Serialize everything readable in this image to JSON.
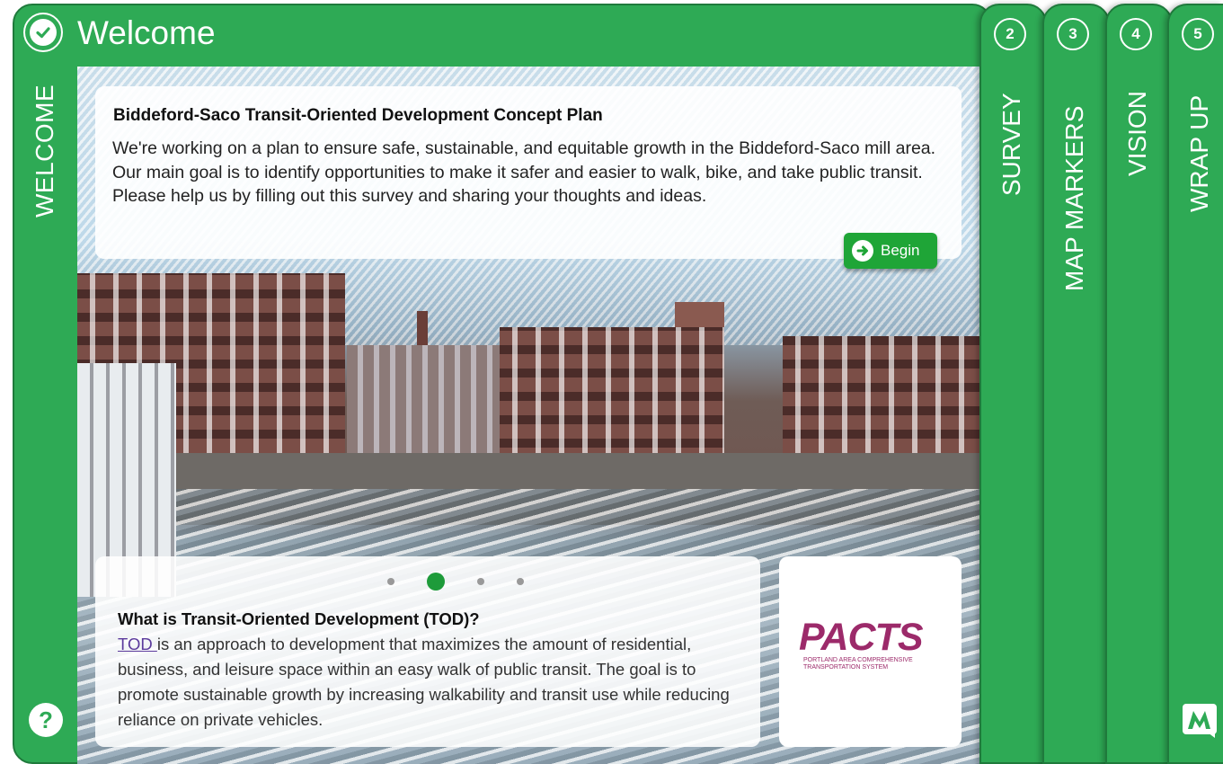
{
  "header": {
    "title": "Welcome"
  },
  "side": {
    "welcome_label": "WELCOME",
    "help_glyph": "?"
  },
  "intro": {
    "title": "Biddeford-Saco Transit-Oriented Development Concept Plan",
    "body": "We're working on a plan to ensure safe, sustainable, and equitable growth in the Biddeford-Saco mill area. Our main goal is to identify opportunities to make it safer and easier to walk, bike, and take public transit. Please help us by filling out this survey and sharing your thoughts and ideas.",
    "begin_label": "Begin"
  },
  "tod": {
    "title": "What is Transit-Oriented Development (TOD)?",
    "link_text": "TOD ",
    "body": "is an approach to development that maximizes the amount of residential, business, and leisure space within an easy walk of public transit. The goal is to promote sustainable growth by increasing walkability and transit use while reducing reliance on private vehicles.",
    "carousel_active_index": 1,
    "carousel_count": 4
  },
  "partner": {
    "logo_text": "PACTS",
    "logo_subtitle": "PORTLAND AREA COMPREHENSIVE TRANSPORTATION SYSTEM"
  },
  "tabs": [
    {
      "number": "2",
      "label": "SURVEY"
    },
    {
      "number": "3",
      "label": "MAP MARKERS"
    },
    {
      "number": "4",
      "label": "VISION"
    },
    {
      "number": "5",
      "label": "WRAP UP"
    }
  ],
  "colors": {
    "brand_green": "#2eaa55",
    "dark_green": "#1f7a3c",
    "pacts_magenta": "#9c2a6a",
    "begin_green": "#1fa537"
  },
  "icons": {
    "step1": "check-icon",
    "help": "question-icon",
    "begin": "arrow-right-circle-icon",
    "brand": "m-logo-icon"
  }
}
